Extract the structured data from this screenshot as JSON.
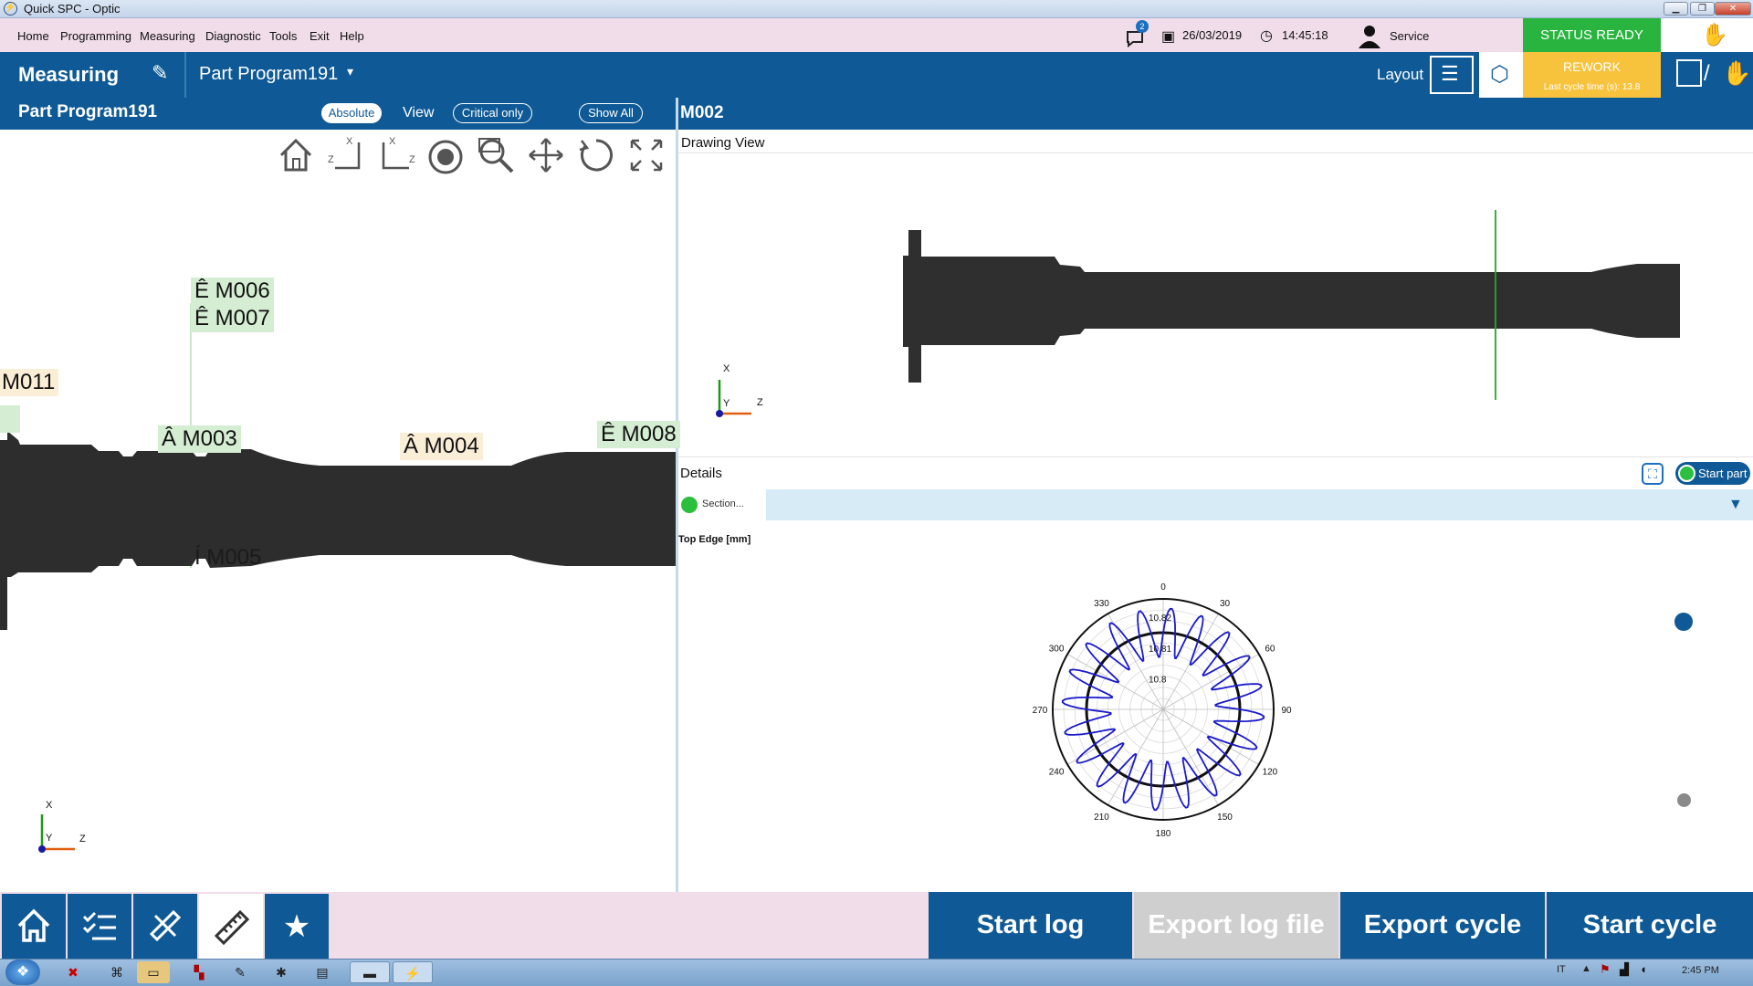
{
  "window": {
    "title": "Quick SPC - Optic"
  },
  "menu": [
    "Home",
    "Programming",
    "Measuring",
    "Diagnostic",
    "Tools",
    "Exit",
    "Help"
  ],
  "topbar": {
    "notification_count": "2",
    "date": "26/03/2019",
    "time": "14:45:18",
    "user": "Service",
    "status": "STATUS READY",
    "rework": "REWORK",
    "last_cycle": "Last cycle time (s): 13.8"
  },
  "toolbar": {
    "mode": "Measuring",
    "program": "Part Program191",
    "layout": "Layout"
  },
  "left_panel": {
    "title": "Part Program191",
    "absolute": "Absolute",
    "view": "View",
    "critical_only": "Critical only",
    "show_all": "Show All",
    "tags": {
      "m006": "Ê M006",
      "m007": "Ê M007",
      "m011": "M011",
      "m003": "Â M003",
      "m004": "Â M004",
      "m008": "Ê M008",
      "m005": "Í M005"
    },
    "axis": {
      "x": "X",
      "y": "Y",
      "z": "Z"
    }
  },
  "right_panel": {
    "title": "M002",
    "drawing_view": "Drawing View",
    "details": "Details",
    "start_part": "Start part",
    "section": "Section...",
    "chart_label": "Top Edge [mm]",
    "axis": {
      "x": "X",
      "y": "Y",
      "z": "Z"
    }
  },
  "chart_data": {
    "type": "polar",
    "title": "Top Edge [mm]",
    "angle_ticks": [
      "0",
      "30",
      "60",
      "90",
      "120",
      "150",
      "180",
      "210",
      "240",
      "270",
      "300",
      "330"
    ],
    "radial_ticks": [
      "10.8",
      "10.81",
      "10.82"
    ],
    "reference_radius": 10.815,
    "series": [
      {
        "color": "#1a1acc",
        "values_summary": "oscillating profile around 10.815 with ~20 lobes",
        "min": 10.807,
        "max": 10.823
      }
    ]
  },
  "bottom": {
    "start_log": "Start log",
    "export_log": "Export log file",
    "export_cycle": "Export cycle",
    "start_cycle": "Start cycle"
  },
  "taskbar": {
    "lang": "IT",
    "clock": "2:45 PM"
  }
}
